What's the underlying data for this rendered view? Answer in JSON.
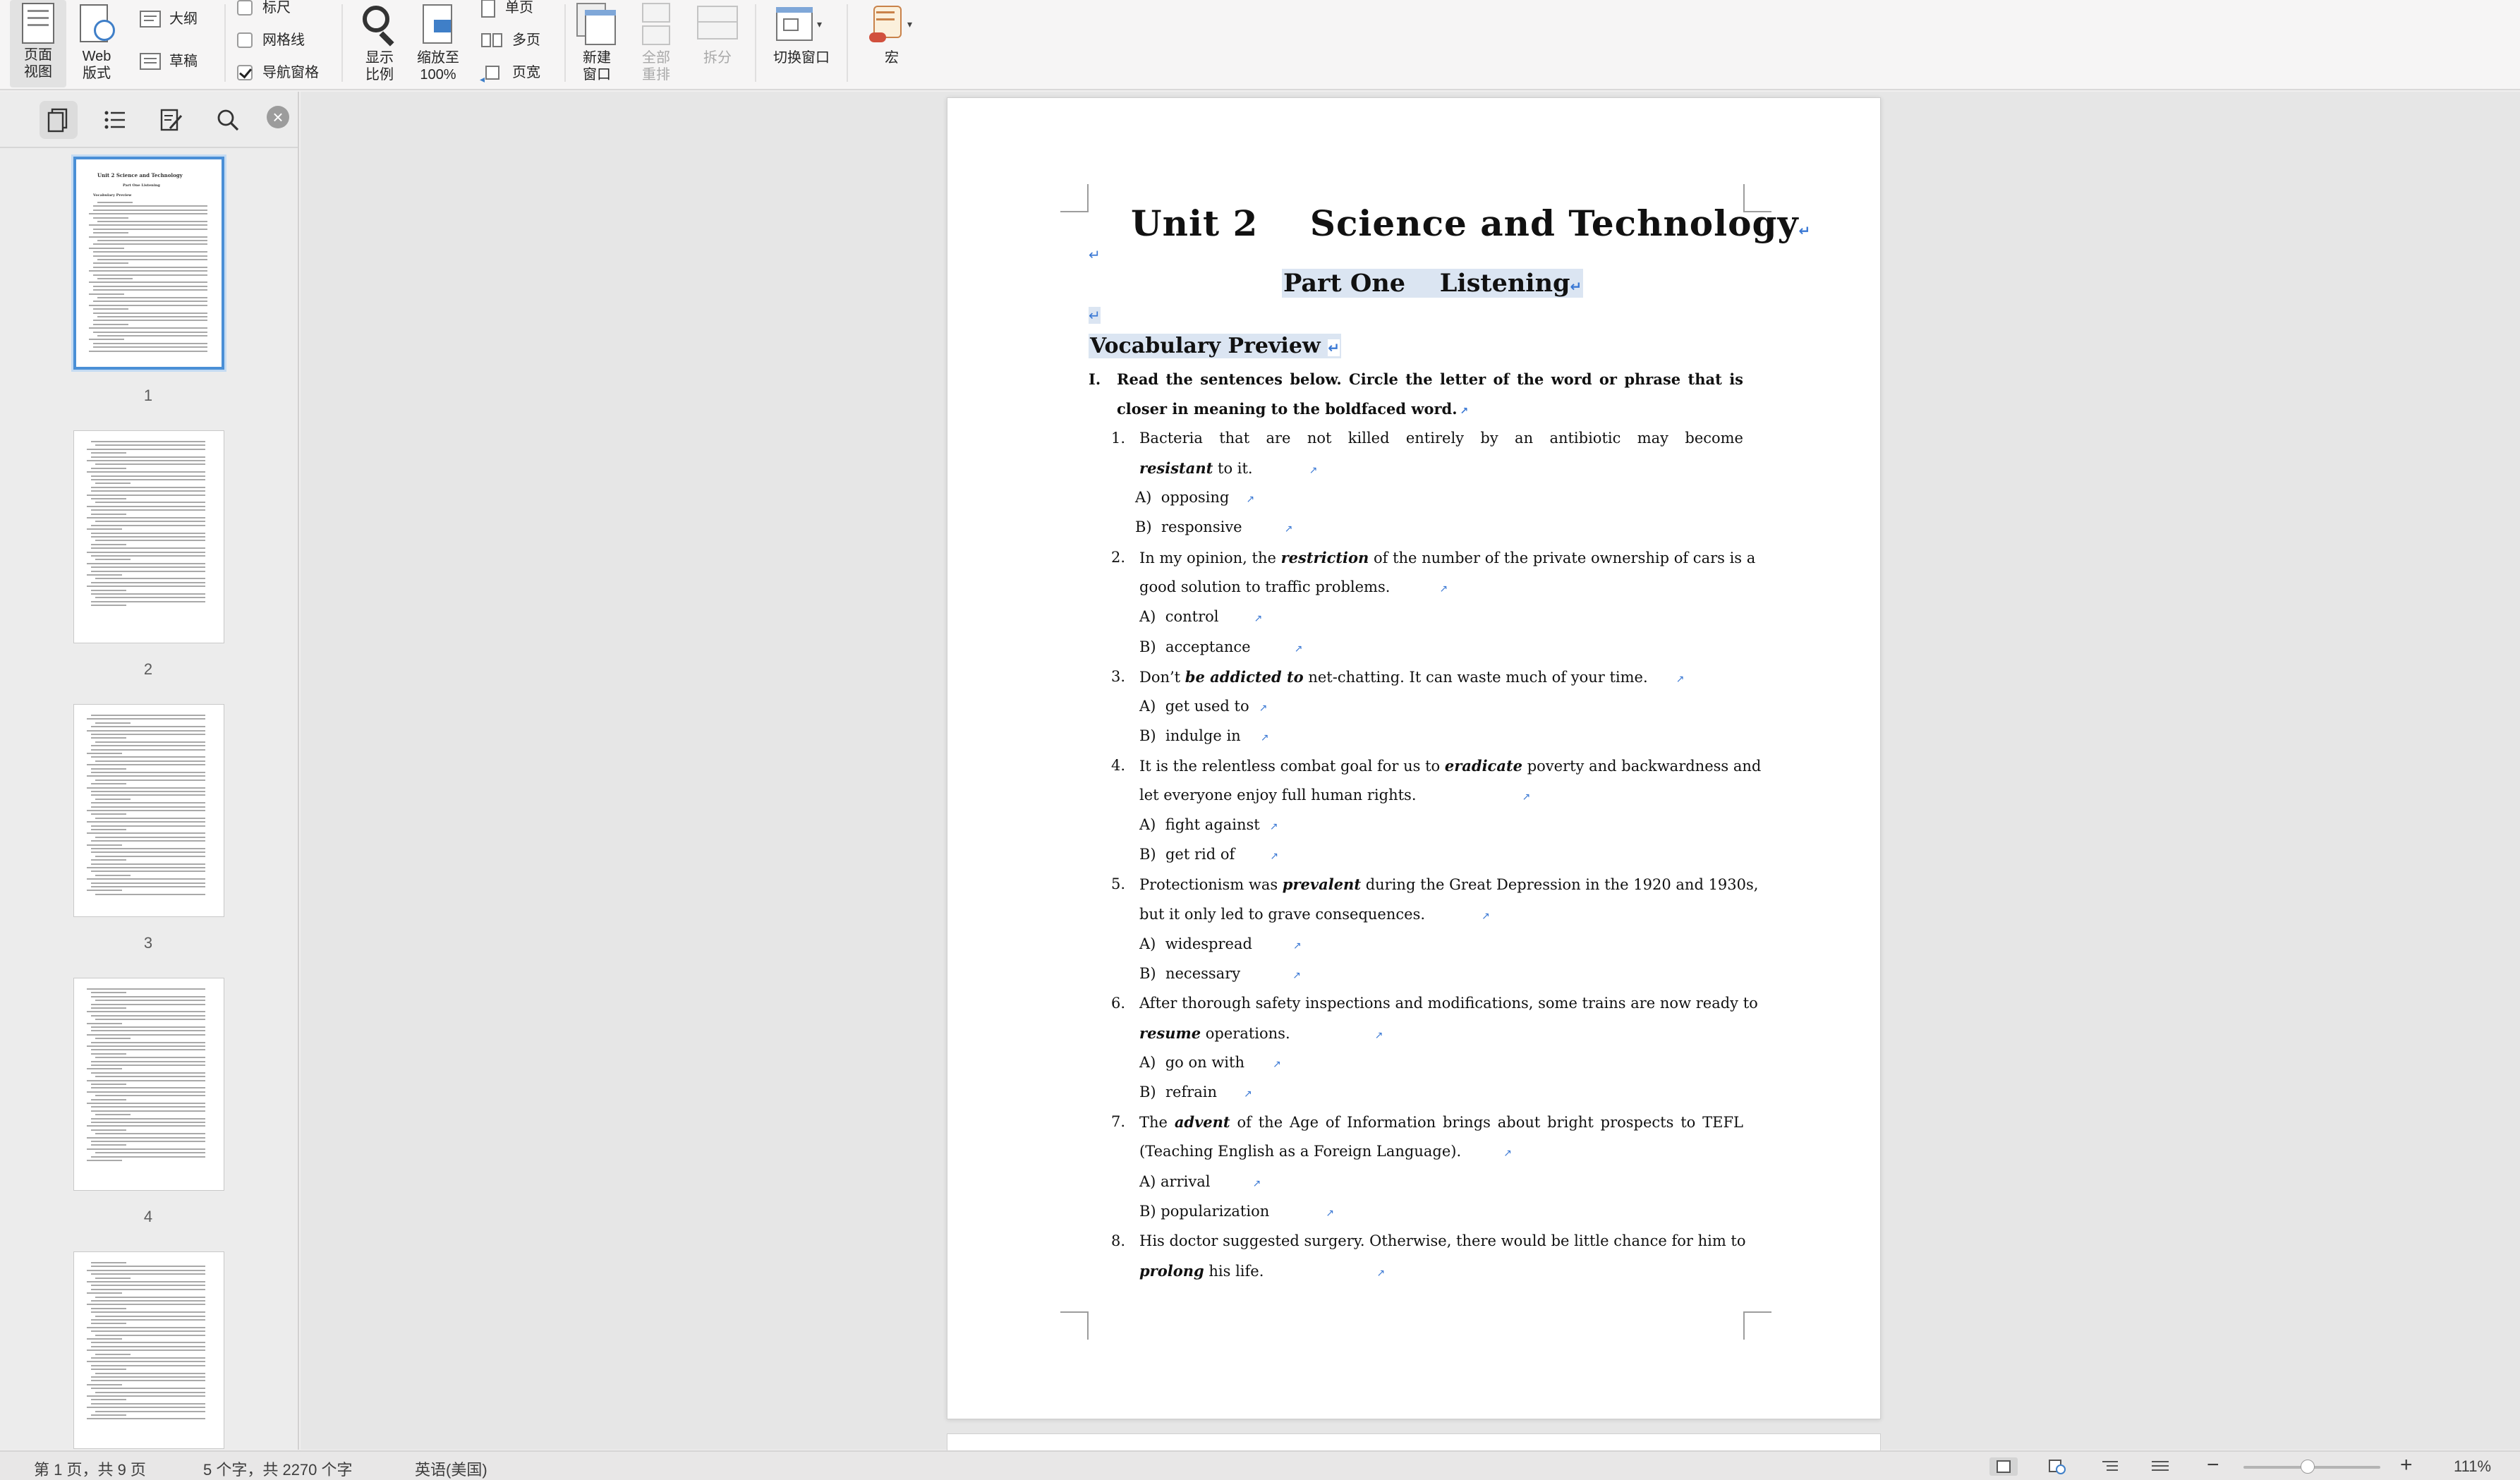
{
  "ribbon": {
    "page_view_label": "页面\n视图",
    "web_view_label": "Web\n版式",
    "outline_label": "大纲",
    "draft_label": "草稿",
    "ruler_label": "标尺",
    "gridlines_label": "网格线",
    "nav_pane_label": "导航窗格",
    "ruler_checked": false,
    "gridlines_checked": false,
    "nav_pane_checked": true,
    "zoom_label": "显示\n比例",
    "zoom100_label": "缩放至\n100%",
    "one_page_label": "单页",
    "multi_page_label": "多页",
    "page_width_label": "页宽",
    "new_window_label": "新建\n窗口",
    "arrange_all_label": "全部\n重排",
    "split_label": "拆分",
    "switch_window_label": "切换窗口",
    "macro_label": "宏"
  },
  "sidebar": {
    "tabs": [
      "thumbnails-icon",
      "outline-list-icon",
      "edit-pane-icon",
      "search-icon"
    ],
    "thumbnails": [
      {
        "page": "1",
        "selected": true
      },
      {
        "page": "2",
        "selected": false
      },
      {
        "page": "3",
        "selected": false
      },
      {
        "page": "4",
        "selected": false
      },
      {
        "page": "5",
        "selected": false
      }
    ],
    "thumb1_title": "Unit 2   Science and Technology",
    "thumb1_sub": "Part One   Listening",
    "thumb1_vocab": "Vocabulary Preview"
  },
  "document": {
    "title": "Unit 2    Science and Technology",
    "subtitle": "Part One    Listening",
    "section_heading": "Vocabulary Preview",
    "instruction_num": "I.",
    "instruction_line1": "Read the sentences below. Circle the letter of the word or phrase that is",
    "instruction_line2": "closer in meaning to the boldfaced word.",
    "q1_num": "1.",
    "q1_l1": "Bacteria that are not killed entirely by an antibiotic may become",
    "q1_kw": "resistant",
    "q1_l2_rest": " to it.",
    "q1_a": "A)  opposing",
    "q1_b": "B)  responsive",
    "q2_num": "2.",
    "q2_l1_pre": "In my opinion, the ",
    "q2_kw": "restriction",
    "q2_l1_post": " of the number of the private ownership of cars is a",
    "q2_l2": "good solution to traffic problems.",
    "q2_a": "A)  control",
    "q2_b": "B)  acceptance",
    "q3_num": "3.",
    "q3_pre": "Don’t ",
    "q3_kw": "be addicted to",
    "q3_post": " net-chatting. It can waste much of your time.",
    "q3_a": "A)  get used to",
    "q3_b": "B)  indulge in",
    "q4_num": "4.",
    "q4_pre": "It is the relentless combat goal for us to ",
    "q4_kw": "eradicate",
    "q4_post": " poverty and backwardness and",
    "q4_l2": "let everyone enjoy full human rights.",
    "q4_a": "A)  fight against",
    "q4_b": "B)  get rid of",
    "q5_num": "5.",
    "q5_pre": "Protectionism was ",
    "q5_kw": "prevalent",
    "q5_post": " during the Great Depression in the 1920 and 1930s,",
    "q5_l2": "but it only led to grave consequences.",
    "q5_a": "A)  widespread",
    "q5_b": "B)  necessary",
    "q6_num": "6.",
    "q6_l1": "After thorough safety inspections and modifications, some trains are now ready to",
    "q6_kw": "resume",
    "q6_l2_rest": " operations.",
    "q6_a": "A)  go on with",
    "q6_b": "B)  refrain",
    "q7_num": "7.",
    "q7_pre": "The ",
    "q7_kw": "advent",
    "q7_post": " of the Age of Information brings about bright prospects to TEFL",
    "q7_l2": "(Teaching English as a Foreign Language).",
    "q7_a": "A) arrival",
    "q7_b": "B) popularization",
    "q8_num": "8.",
    "q8_l1": "His doctor suggested surgery. Otherwise, there would be little chance for him to",
    "q8_kw": "prolong",
    "q8_l2_rest": " his life."
  },
  "statusbar": {
    "page_info": "第 1 页，共 9 页",
    "word_count": "5 个字，共 2270 个字",
    "language": "英语(美国)",
    "zoom_percent": "111%",
    "zoom_minus": "−",
    "zoom_plus": "+",
    "zoom_value": 0.47
  },
  "colors": {
    "highlight": "#dbe5f2",
    "mark": "#3a78d4",
    "thumb_selected": "#4a8fd6"
  }
}
